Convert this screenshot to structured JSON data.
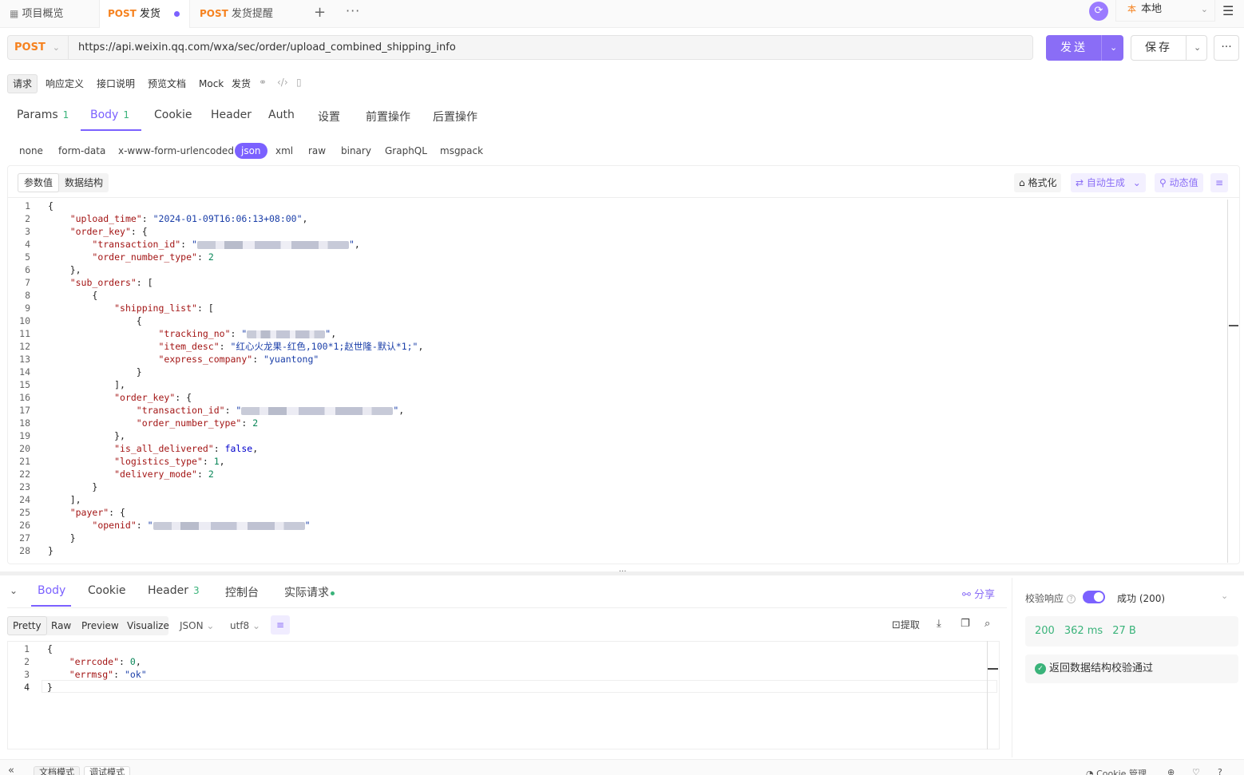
{
  "tabs": {
    "overview": "项目概览",
    "active": {
      "method": "POST",
      "name": "发货"
    },
    "second": {
      "method": "POST",
      "name": "发货提醒"
    }
  },
  "env": {
    "badge": "本",
    "name": "本地"
  },
  "request": {
    "method": "POST",
    "url": "https://api.weixin.qq.com/wxa/sec/order/upload_combined_shipping_info",
    "send_label": "发送",
    "save_label": "保存"
  },
  "subtabs": [
    "请求",
    "响应定义",
    "接口说明",
    "预览文档",
    "Mock",
    "发货"
  ],
  "param_tabs": [
    {
      "label": "Params",
      "count": "1"
    },
    {
      "label": "Body",
      "count": "1"
    },
    {
      "label": "Cookie",
      "count": ""
    },
    {
      "label": "Header",
      "count": ""
    },
    {
      "label": "Auth",
      "count": ""
    },
    {
      "label": "设置",
      "count": ""
    },
    {
      "label": "前置操作",
      "count": ""
    },
    {
      "label": "后置操作",
      "count": ""
    }
  ],
  "body_types": [
    "none",
    "form-data",
    "x-www-form-urlencoded",
    "json",
    "xml",
    "raw",
    "binary",
    "GraphQL",
    "msgpack"
  ],
  "editor": {
    "mode_values": "参数值",
    "mode_schema": "数据结构",
    "format": "格式化",
    "auto_gen": "自动生成",
    "dynamic": "动态值"
  },
  "json_body": {
    "upload_time": "2024-01-09T16:06:13+08:00",
    "order_number_type": "2",
    "item_desc": "红心火龙果-红色,100*1;赵世隆-默认*1;",
    "express_company": "yuantong",
    "is_all_delivered": "false",
    "logistics_type": "1",
    "delivery_mode": "2"
  },
  "response": {
    "tabs": [
      {
        "label": "Body",
        "count": ""
      },
      {
        "label": "Cookie",
        "count": ""
      },
      {
        "label": "Header",
        "count": "3"
      },
      {
        "label": "控制台",
        "count": ""
      },
      {
        "label": "实际请求",
        "count": ""
      }
    ],
    "share": "分享",
    "views": [
      "Pretty",
      "Raw",
      "Preview",
      "Visualize"
    ],
    "format": "JSON",
    "encoding": "utf8",
    "extract": "提取",
    "errcode": "0",
    "errmsg": "ok"
  },
  "validation": {
    "label": "校验响应",
    "status": "成功 (200)",
    "code": "200",
    "time": "362 ms",
    "size": "27 B",
    "message": "返回数据结构校验通过"
  },
  "footer": {
    "doc_mode": "文档模式",
    "debug_mode": "调试模式",
    "cookie": "Cookie 管理"
  },
  "colors": {
    "accent": "#7b61ff",
    "method": "#f6821f",
    "success": "#3ab37a"
  }
}
